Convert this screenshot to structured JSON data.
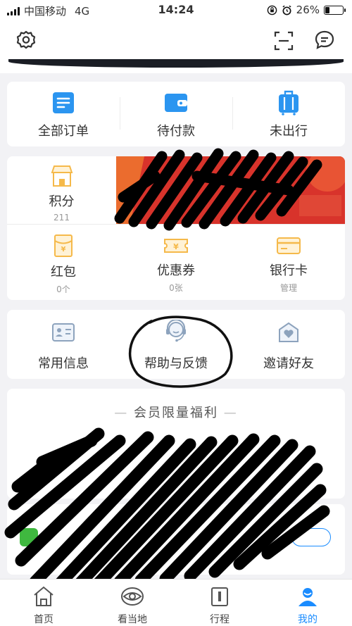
{
  "status_bar": {
    "carrier": "中国移动",
    "network": "4G",
    "time": "14:24",
    "battery": "26%",
    "battery_level": 0.26
  },
  "orders": [
    {
      "label": "全部订单",
      "icon": "order-list-icon"
    },
    {
      "label": "待付款",
      "icon": "wallet-icon"
    },
    {
      "label": "未出行",
      "icon": "luggage-icon"
    }
  ],
  "assets": {
    "points": {
      "label": "积分",
      "value": "211",
      "icon": "shop-icon"
    },
    "row": [
      {
        "label": "红包",
        "value": "0个",
        "icon": "red-envelope-icon"
      },
      {
        "label": "优惠券",
        "value": "0张",
        "icon": "coupon-icon"
      },
      {
        "label": "银行卡",
        "value": "管理",
        "icon": "bank-card-icon"
      }
    ]
  },
  "services": [
    {
      "label": "常用信息",
      "icon": "id-card-icon"
    },
    {
      "label": "帮助与反馈",
      "icon": "customer-service-icon"
    },
    {
      "label": "邀请好友",
      "icon": "invite-heart-icon"
    }
  ],
  "welfare": {
    "title": "会员限量福利"
  },
  "tabs": [
    {
      "label": "首页",
      "icon": "home-icon"
    },
    {
      "label": "看当地",
      "icon": "eye-icon"
    },
    {
      "label": "行程",
      "icon": "itinerary-icon"
    },
    {
      "label": "我的",
      "icon": "profile-icon",
      "active": true
    }
  ],
  "colors": {
    "accent": "#1a8cff",
    "gold": "#f5b94a",
    "tab_active": "#1a8cff"
  }
}
